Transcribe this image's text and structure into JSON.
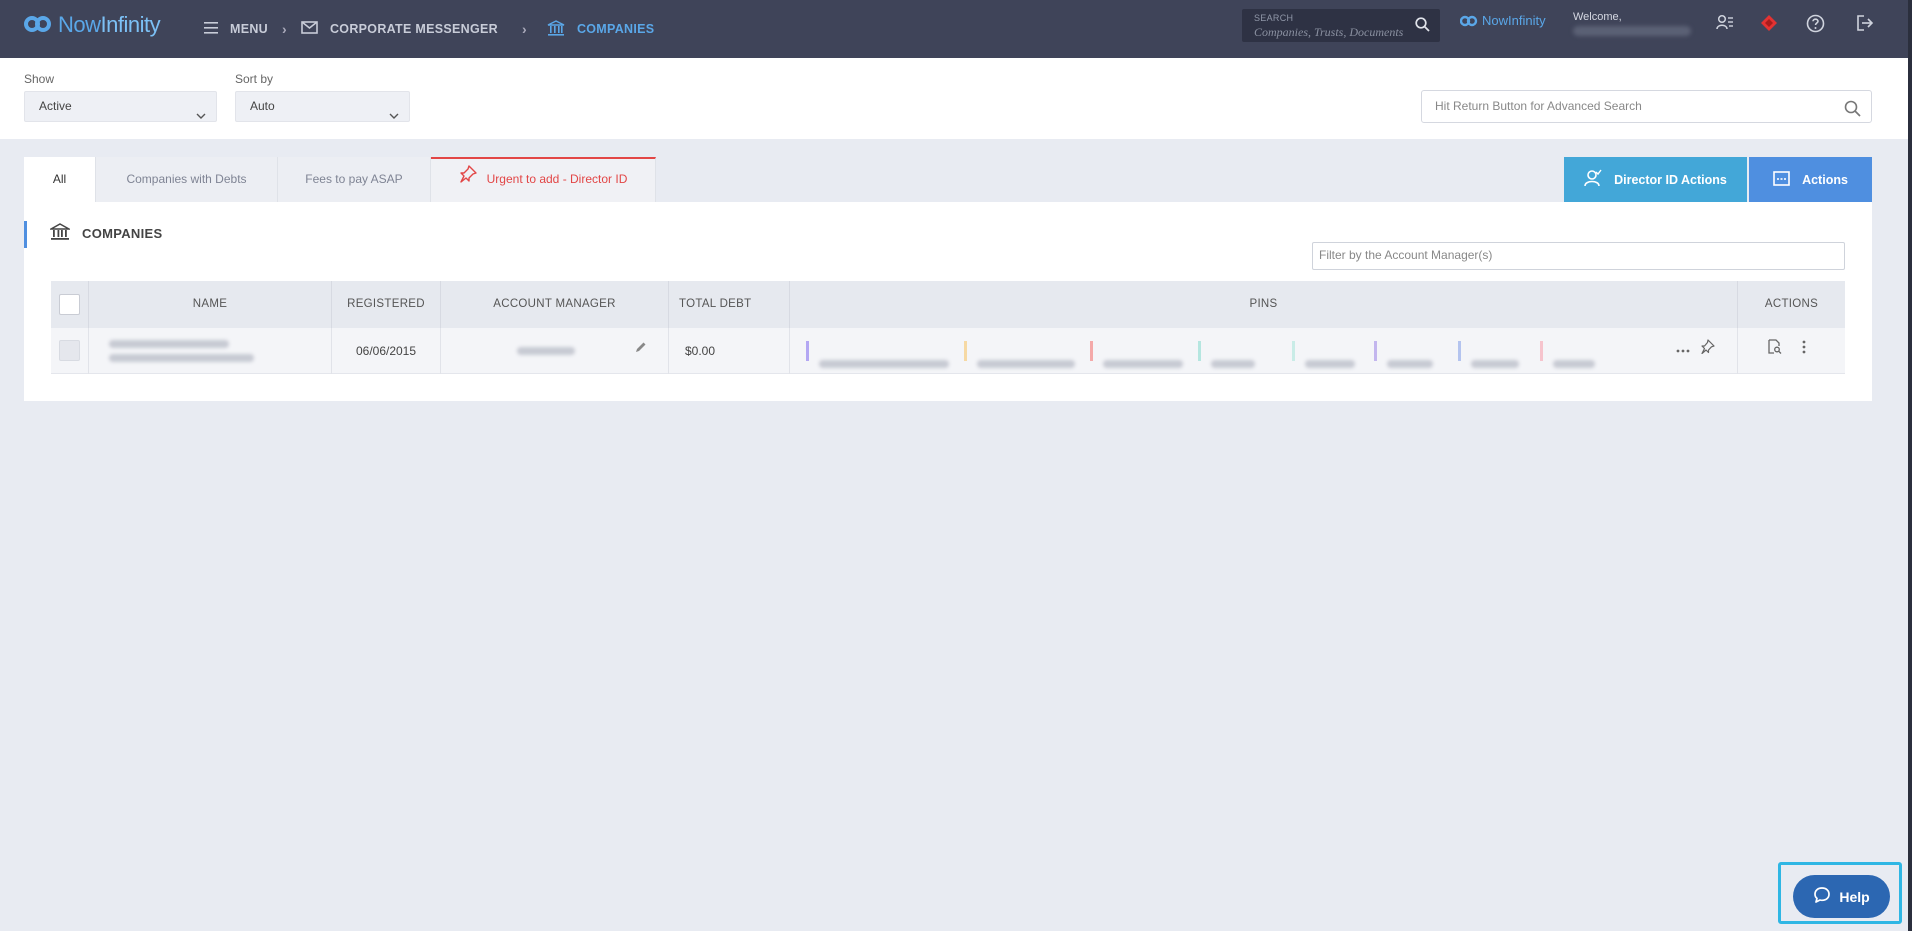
{
  "topbar": {
    "brand": {
      "now": "Now",
      "infinity": "Infinity"
    },
    "nav": {
      "menu": "MENU",
      "messenger": "CORPORATE MESSENGER",
      "companies": "COMPANIES"
    },
    "search": {
      "label": "SEARCH",
      "placeholder": "Companies, Trusts, Documents"
    },
    "small_brand": "NowInfinity",
    "welcome": "Welcome,",
    "icons": [
      "menu-icon",
      "mail-icon",
      "bank-icon",
      "search-icon",
      "user-list-icon",
      "diamond-icon",
      "help-circle-icon",
      "logout-icon"
    ]
  },
  "filters": {
    "show_label": "Show",
    "show_value": "Active",
    "sort_label": "Sort by",
    "sort_value": "Auto",
    "advanced_search_placeholder": "Hit Return Button for Advanced Search"
  },
  "tabs": [
    {
      "label": "All",
      "active": true
    },
    {
      "label": "Companies with Debts"
    },
    {
      "label": "Fees to pay ASAP"
    },
    {
      "label": "Urgent to add - Director ID",
      "urgent": true
    }
  ],
  "actions": {
    "director_id": "Director ID Actions",
    "actions": "Actions"
  },
  "section": {
    "title": "COMPANIES",
    "account_manager_filter_placeholder": "Filter by the Account Manager(s)"
  },
  "table": {
    "headers": {
      "name": "NAME",
      "registered": "REGISTERED",
      "account_manager": "ACCOUNT MANAGER",
      "total_debt": "TOTAL DEBT",
      "pins": "PINS",
      "actions": "ACTIONS"
    },
    "rows": [
      {
        "registered": "06/06/2015",
        "total_debt": "$0.00"
      }
    ]
  },
  "colors": {
    "topbar": "#3f4459",
    "accent": "#4f8fe0",
    "director_button": "#43a7d8",
    "urgent": "#e24646",
    "help_button": "#2c67b2",
    "pin_colors": [
      "#9b8cf0",
      "#f2c77a",
      "#f08a8a",
      "#8fd8d0",
      "#a8e2dc",
      "#a995e8",
      "#8fa6e8",
      "#f2a3b0"
    ]
  },
  "help": {
    "label": "Help"
  }
}
